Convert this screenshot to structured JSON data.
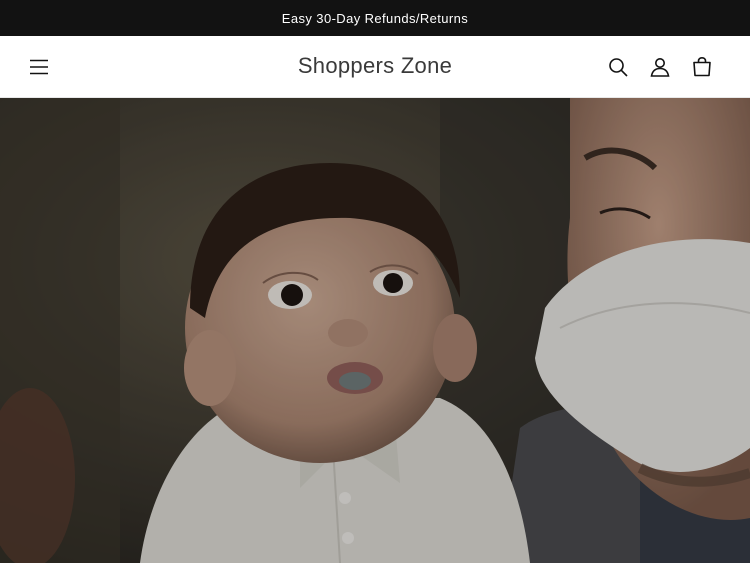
{
  "announcement": {
    "text": "Easy 30-Day Refunds/Returns"
  },
  "header": {
    "logo": "Shoppers Zone",
    "icons": [
      "menu-icon",
      "search-icon",
      "account-icon",
      "cart-icon"
    ]
  },
  "hero": {
    "image": "baby-in-bowtie-held-by-masked-man-photo"
  },
  "colors": {
    "announcement_bg": "#121212",
    "header_bg": "#ffffff",
    "text": "#121212"
  }
}
